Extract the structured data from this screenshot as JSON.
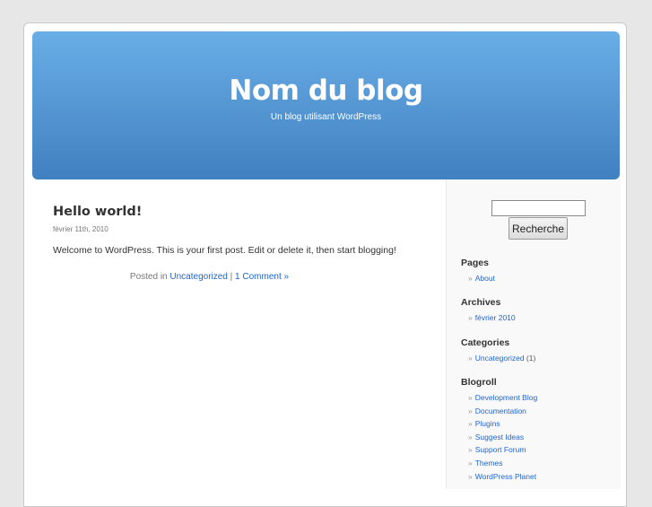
{
  "header": {
    "title": "Nom du blog",
    "description": "Un blog utilisant WordPress"
  },
  "post": {
    "title": "Hello world!",
    "date": "février 11th, 2010",
    "body": "Welcome to WordPress. This is your first post. Edit or delete it, then start blogging!",
    "meta_prefix": "Posted in",
    "category": "Uncategorized",
    "separator": "|",
    "comments": "1 Comment »"
  },
  "sidebar": {
    "search_button": "Recherche",
    "search_value": "",
    "pages": {
      "title": "Pages",
      "items": [
        "About"
      ]
    },
    "archives": {
      "title": "Archives",
      "items": [
        "février 2010"
      ]
    },
    "categories": {
      "title": "Categories",
      "items": [
        {
          "label": "Uncategorized",
          "count": "(1)"
        }
      ]
    },
    "blogroll": {
      "title": "Blogroll",
      "items": [
        "Development Blog",
        "Documentation",
        "Plugins",
        "Suggest Ideas",
        "Support Forum",
        "Themes",
        "WordPress Planet"
      ]
    },
    "bullet": "»"
  }
}
